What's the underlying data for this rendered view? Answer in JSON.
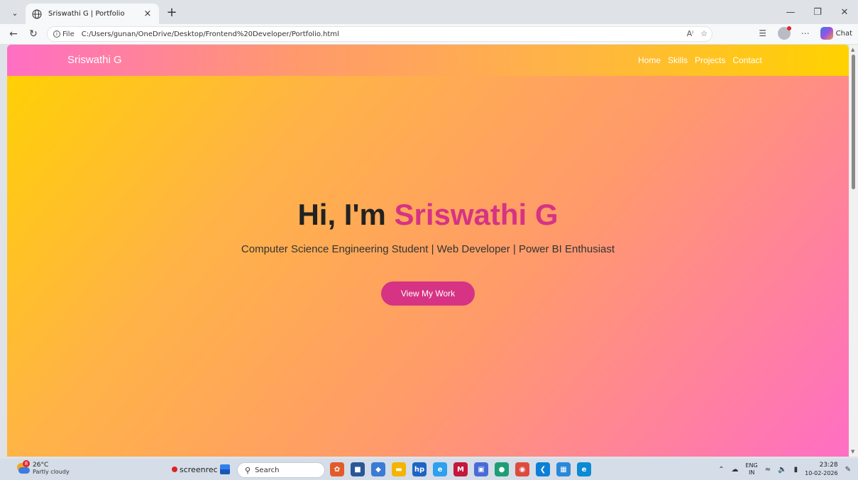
{
  "browser": {
    "tab_title": "Sriswathi G | Portfolio",
    "tab_close": "×",
    "new_tab": "+",
    "url_label": "File",
    "url": "C:/Users/gunan/OneDrive/Desktop/Frontend%20Developer/Portfolio.html",
    "chat_label": "Chat"
  },
  "site": {
    "logo": "Sriswathi G",
    "nav": [
      "Home",
      "Skills",
      "Projects",
      "Contact"
    ],
    "hero": {
      "greeting": "Hi, I'm ",
      "name": "Sriswathi G",
      "subtitle": "Computer Science Engineering Student | Web Developer | Power BI Enthusiast",
      "cta": "View My Work"
    },
    "colors": {
      "accent": "#d63384",
      "gradient_start": "#ffd200",
      "gradient_end": "#ff6ec4"
    }
  },
  "taskbar": {
    "weather_temp": "26°C",
    "weather_desc": "Partly cloudy",
    "weather_badge": "8",
    "screenrec": "screenrec",
    "search_placeholder": "Search",
    "lang_top": "ENG",
    "lang_bottom": "IN",
    "time": "23:28",
    "date": "10-02-2026"
  }
}
